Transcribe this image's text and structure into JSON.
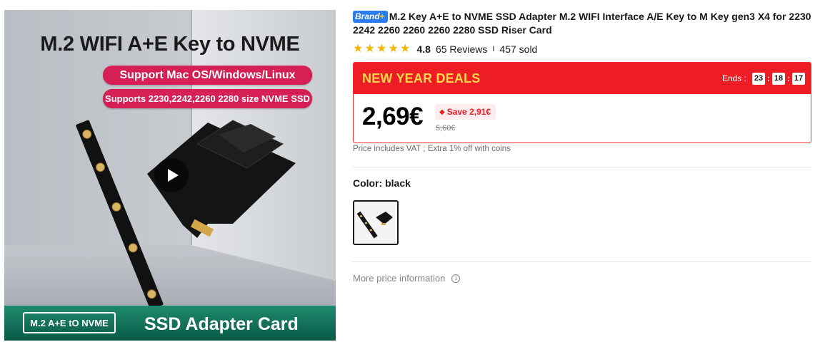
{
  "product_image": {
    "headline": "M.2 WIFI A+E Key to NVME",
    "pill_os": "Support Mac OS/Windows/Linux",
    "pill_sizes": "Supports 2230,2242,2260 2280 size NVME SSD",
    "footer_left": "M.2 A+E tO NVME",
    "footer_right": "SSD Adapter Card",
    "video_icon": "play-icon"
  },
  "product": {
    "brand_badge": "Brand",
    "brand_plus": "+",
    "title": "M.2 Key A+E to NVME SSD Adapter M.2 WIFI Interface A/E Key to M Key gen3 X4 for 2230 2242 2260 2260 2260 2280 SSD Riser Card",
    "rating": "4.8",
    "stars": 5,
    "reviews": "65 Reviews",
    "separator": "I",
    "sold": "457 sold"
  },
  "deal": {
    "title": "NEW YEAR DEALS",
    "ends_label": "Ends :",
    "countdown": {
      "hours": "23",
      "minutes": "18",
      "seconds": "17"
    },
    "price": "2,69€",
    "save": "Save 2,91€",
    "original_price": "5,60€",
    "vat_note": "Price includes VAT ; Extra 1% off with coins"
  },
  "variant": {
    "color_label": "Color: black"
  },
  "more_info": {
    "label": "More price information",
    "icon": "info-icon"
  },
  "colors": {
    "deal_red": "#ee1c25",
    "deal_title_yellow": "#ffd84a",
    "pill_pink": "#d61f55",
    "star_gold": "#f7b500",
    "brand_blue": "#2a7af0",
    "footer_green": "#0d6b55"
  }
}
